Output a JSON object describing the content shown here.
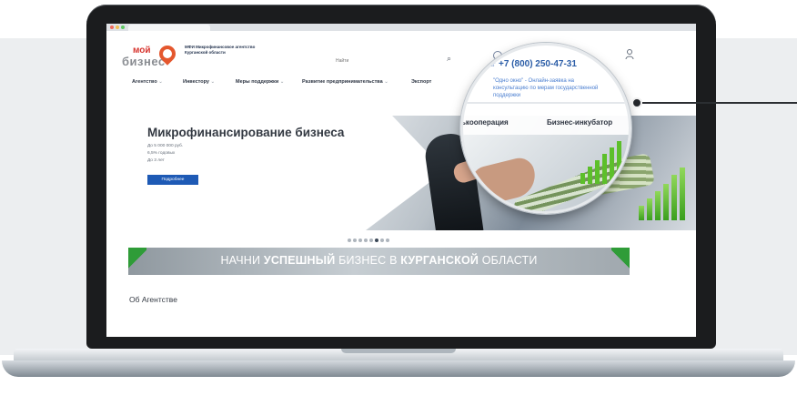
{
  "brand": {
    "logo_word1": "мой",
    "logo_word2": "бизнес",
    "org_name": "МФИ Микрофинансовое агентство Курганской области"
  },
  "header": {
    "search_placeholder": "Найти",
    "phone": "+7 (800) 250-47-31",
    "consult_link": "\"Одно окно\" - Онлайн-заявка на консультацию по мерам государственной поддержки"
  },
  "nav": {
    "items": [
      {
        "label": "Агентство"
      },
      {
        "label": "Инвестору"
      },
      {
        "label": "Меры поддержки"
      },
      {
        "label": "Развитие предпринимательства"
      },
      {
        "label": "Экспорт"
      },
      {
        "label": "Сельхозкооперация"
      },
      {
        "label": "Бизнес-инкубатор"
      }
    ],
    "magnified_coop": "ькооперация"
  },
  "hero": {
    "title": "Микрофинансирование бизнеса",
    "lines": [
      "До 5 000 000 руб.",
      "6,5% годовых",
      "До 3 лет"
    ],
    "button_label": "Подробнее",
    "slides_count": 8,
    "active_slide": 6
  },
  "banner": {
    "part1": "НАЧНИ ",
    "part2": "УСПЕШНЫЙ",
    "part3": " БИЗНЕС В ",
    "part4": "КУРГАНСКОЙ",
    "part5": " ОБЛАСТИ"
  },
  "about": {
    "title": "Об Агентстве"
  },
  "colors": {
    "brand_red": "#d7352f",
    "accent_blue": "#1e5ab5",
    "accent_green": "#2f9c38"
  }
}
